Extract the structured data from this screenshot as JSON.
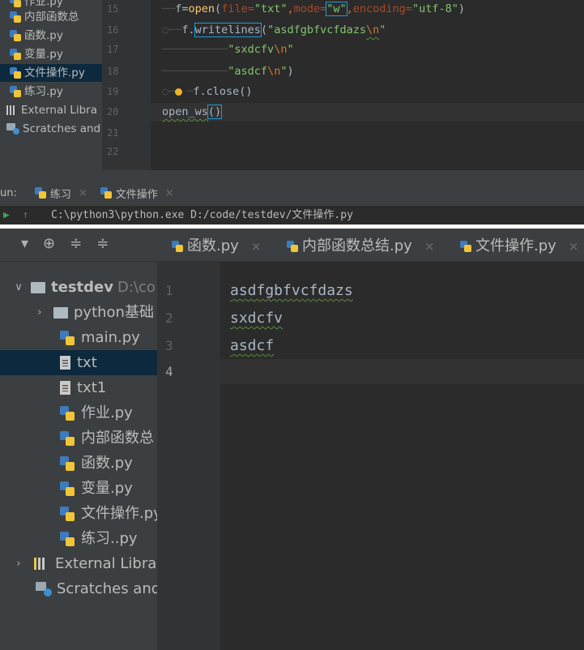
{
  "top": {
    "project_items": [
      {
        "label": "作业.py",
        "icon": "python-file-icon"
      },
      {
        "label": "内部函数总",
        "icon": "python-file-icon"
      },
      {
        "label": "函数.py",
        "icon": "python-file-icon"
      },
      {
        "label": "变量.py",
        "icon": "python-file-icon"
      },
      {
        "label": "文件操作.py",
        "icon": "python-file-icon",
        "selected": true
      },
      {
        "label": "练习.py",
        "icon": "python-file-icon"
      },
      {
        "label": "External Libra",
        "icon": "library-icon"
      },
      {
        "label": "Scratches and",
        "icon": "scratches-icon"
      }
    ],
    "line_numbers": [
      "15",
      "16",
      "17",
      "18",
      "19",
      "20",
      "21",
      "22"
    ],
    "code_tokens": {
      "l15_a": "f=",
      "l15_b": "open",
      "l15_c": "(",
      "l15_d": "file=",
      "l15_e": "\"txt\"",
      "l15_f": ",",
      "l15_g": "mode=",
      "l15_h": "\"w\"",
      "l15_i": ",",
      "l15_j": "encoding=",
      "l15_k": "\"utf-8\"",
      "l15_l": ")",
      "l16_a": "f.",
      "l16_b": "writelines",
      "l16_c": "(",
      "l16_d": "\"asdfgbfvcfdazs",
      "l16_e": "\\n",
      "l16_f": "\"",
      "l17_a": "\"sxdcfv",
      "l17_b": "\\n",
      "l17_c": "\"",
      "l18_a": "\"asdcf",
      "l18_b": "\\n",
      "l18_c": "\"",
      "l18_d": ")",
      "l19": "f.close()",
      "l20_a": "open_ws",
      "l20_b": "()"
    },
    "run": {
      "label": "un:",
      "tabs": [
        {
          "label": "练习",
          "close": "×"
        },
        {
          "label": "文件操作",
          "close": "×"
        }
      ],
      "command": "C:\\python3\\python.exe D:/code/testdev/文件操作.py"
    }
  },
  "bottom": {
    "tabs": [
      {
        "label": "函数.py",
        "close": "×"
      },
      {
        "label": "内部函数总结.py",
        "close": "×"
      },
      {
        "label": "文件操作.py",
        "close": "×"
      }
    ],
    "tree": [
      {
        "label": "testdev",
        "suffix": "D:\\co",
        "type": "folder",
        "expanded": true
      },
      {
        "label": "python基础",
        "type": "folder",
        "collapsed": true
      },
      {
        "label": "main.py",
        "type": "python"
      },
      {
        "label": "txt",
        "type": "text",
        "selected": true
      },
      {
        "label": "txt1",
        "type": "text"
      },
      {
        "label": "作业.py",
        "type": "python"
      },
      {
        "label": "内部函数总",
        "type": "python"
      },
      {
        "label": "函数.py",
        "type": "python"
      },
      {
        "label": "变量.py",
        "type": "python"
      },
      {
        "label": "文件操作.py",
        "type": "python"
      },
      {
        "label": "练习..py",
        "type": "python"
      },
      {
        "label": "External Libra",
        "type": "library",
        "collapsed": true
      },
      {
        "label": "Scratches and",
        "type": "scratches"
      }
    ],
    "line_numbers": [
      "1",
      "2",
      "3",
      "4"
    ],
    "file_lines": [
      "asdfgbfvcfdazs",
      "sxdcfv",
      "asdcf",
      ""
    ]
  }
}
